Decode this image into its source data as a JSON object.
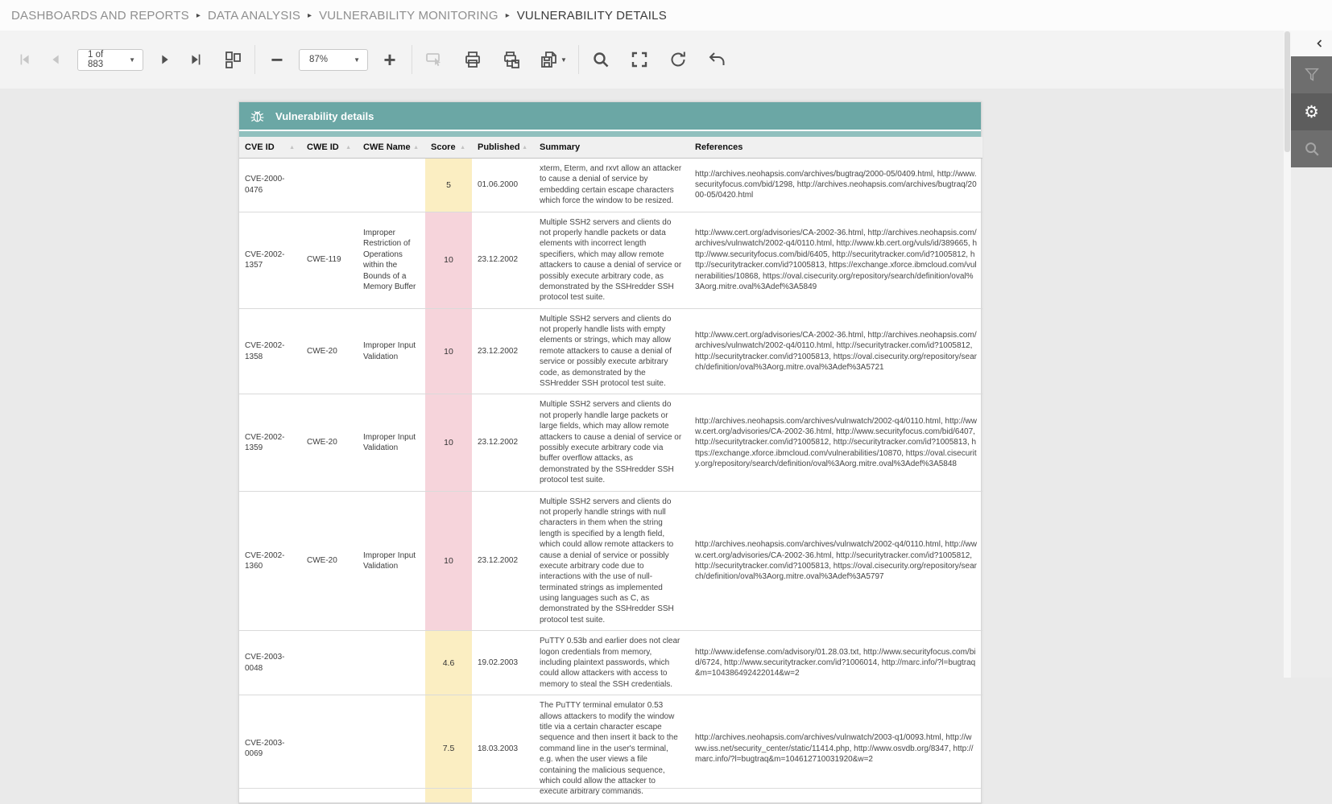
{
  "breadcrumb": {
    "items": [
      "DASHBOARDS AND REPORTS",
      "DATA ANALYSIS",
      "VULNERABILITY MONITORING",
      "VULNERABILITY DETAILS"
    ],
    "separator": "▸"
  },
  "toolbar": {
    "page_value": "1 of 883",
    "zoom_value": "87%",
    "zoom_out_label": "−",
    "zoom_in_label": "+"
  },
  "rail": {
    "icons": [
      "collapse-panel",
      "filter",
      "settings",
      "search"
    ],
    "gear_glyph": "⚙"
  },
  "report": {
    "title": "Vulnerability details",
    "columns": [
      {
        "label": "CVE ID",
        "sortable": true
      },
      {
        "label": "CWE ID",
        "sortable": true
      },
      {
        "label": "CWE Name",
        "sortable": true
      },
      {
        "label": "Score",
        "sortable": true
      },
      {
        "label": "Published",
        "sortable": true
      },
      {
        "label": "Summary",
        "sortable": false
      },
      {
        "label": "References",
        "sortable": false
      }
    ],
    "sort_glyph": "▲",
    "rows": [
      {
        "cve": "CVE-2000-0476",
        "cwe_id": "",
        "cwe_name": "",
        "score": "5",
        "score_level": "medium",
        "published": "01.06.2000",
        "summary": "xterm, Eterm, and rxvt allow an attacker to cause a denial of service by embedding certain escape characters which force the window to be resized.",
        "references": "http://archives.neohapsis.com/archives/bugtraq/2000-05/0409.html, http://www.securityfocus.com/bid/1298, http://archives.neohapsis.com/archives/bugtraq/2000-05/0420.html"
      },
      {
        "cve": "CVE-2002-1357",
        "cwe_id": "CWE-119",
        "cwe_name": "Improper Restriction of Operations within the Bounds of a Memory Buffer",
        "score": "10",
        "score_level": "high",
        "published": "23.12.2002",
        "summary": "Multiple SSH2 servers and clients do not properly handle packets or data elements with incorrect length specifiers, which may allow remote attackers to cause a denial of service or possibly execute arbitrary code, as demonstrated by the SSHredder SSH protocol test suite.",
        "references": "http://www.cert.org/advisories/CA-2002-36.html, http://archives.neohapsis.com/archives/vulnwatch/2002-q4/0110.html, http://www.kb.cert.org/vuls/id/389665, http://www.securityfocus.com/bid/6405, http://securitytracker.com/id?1005812, http://securitytracker.com/id?1005813, https://exchange.xforce.ibmcloud.com/vulnerabilities/10868, https://oval.cisecurity.org/repository/search/definition/oval%3Aorg.mitre.oval%3Adef%3A5849"
      },
      {
        "cve": "CVE-2002-1358",
        "cwe_id": "CWE-20",
        "cwe_name": "Improper Input Validation",
        "score": "10",
        "score_level": "high",
        "published": "23.12.2002",
        "summary": "Multiple SSH2 servers and clients do not properly handle lists with empty elements or strings, which may allow remote attackers to cause a denial of service or possibly execute arbitrary code, as demonstrated by the SSHredder SSH protocol test suite.",
        "references": "http://www.cert.org/advisories/CA-2002-36.html, http://archives.neohapsis.com/archives/vulnwatch/2002-q4/0110.html, http://securitytracker.com/id?1005812, http://securitytracker.com/id?1005813, https://oval.cisecurity.org/repository/search/definition/oval%3Aorg.mitre.oval%3Adef%3A5721"
      },
      {
        "cve": "CVE-2002-1359",
        "cwe_id": "CWE-20",
        "cwe_name": "Improper Input Validation",
        "score": "10",
        "score_level": "high",
        "published": "23.12.2002",
        "summary": "Multiple SSH2 servers and clients do not properly handle large packets or large fields, which may allow remote attackers to cause a denial of service or possibly execute arbitrary code via buffer overflow attacks, as demonstrated by the SSHredder SSH protocol test suite.",
        "references": "http://archives.neohapsis.com/archives/vulnwatch/2002-q4/0110.html, http://www.cert.org/advisories/CA-2002-36.html, http://www.securityfocus.com/bid/6407, http://securitytracker.com/id?1005812, http://securitytracker.com/id?1005813, https://exchange.xforce.ibmcloud.com/vulnerabilities/10870, https://oval.cisecurity.org/repository/search/definition/oval%3Aorg.mitre.oval%3Adef%3A5848"
      },
      {
        "cve": "CVE-2002-1360",
        "cwe_id": "CWE-20",
        "cwe_name": "Improper Input Validation",
        "score": "10",
        "score_level": "high",
        "published": "23.12.2002",
        "summary": "Multiple SSH2 servers and clients do not properly handle strings with null characters in them when the string length is specified by a length field, which could allow remote attackers to cause a denial of service or possibly execute arbitrary code due to interactions with the use of null-terminated strings as implemented using languages such as C, as demonstrated by the SSHredder SSH protocol test suite.",
        "references": "http://archives.neohapsis.com/archives/vulnwatch/2002-q4/0110.html, http://www.cert.org/advisories/CA-2002-36.html, http://securitytracker.com/id?1005812, http://securitytracker.com/id?1005813, https://oval.cisecurity.org/repository/search/definition/oval%3Aorg.mitre.oval%3Adef%3A5797"
      },
      {
        "cve": "CVE-2003-0048",
        "cwe_id": "",
        "cwe_name": "",
        "score": "4.6",
        "score_level": "medium",
        "published": "19.02.2003",
        "summary": "PuTTY 0.53b and earlier does not clear logon credentials from memory, including plaintext passwords, which could allow attackers with access to memory to steal the SSH credentials.",
        "references": "http://www.idefense.com/advisory/01.28.03.txt, http://www.securityfocus.com/bid/6724, http://www.securitytracker.com/id?1006014, http://marc.info/?l=bugtraq&m=104386492422014&w=2"
      },
      {
        "cve": "CVE-2003-0069",
        "cwe_id": "",
        "cwe_name": "",
        "score": "7.5",
        "score_level": "medium",
        "published": "18.03.2003",
        "summary": "The PuTTY terminal emulator 0.53 allows attackers to modify the window title via a certain character escape sequence and then insert it back to the command line in the user's terminal, e.g. when the user views a file containing the malicious sequence, which could allow the attacker to execute arbitrary commands.",
        "references": "http://archives.neohapsis.com/archives/vulnwatch/2003-q1/0093.html, http://www.iss.net/security_center/static/11414.php, http://www.osvdb.org/8347, http://marc.info/?l=bugtraq&m=104612710031920&w=2"
      }
    ]
  },
  "colors": {
    "accent_teal": "#6ba7a5",
    "accent_teal_light": "#90c0be",
    "score_medium_bg": "#fbeec2",
    "score_high_bg": "#f6d4db",
    "header_row_bg": "#f0f0f0",
    "rail_bg": "#6e6e6e",
    "rail_active_bg": "#5d5d5d"
  }
}
